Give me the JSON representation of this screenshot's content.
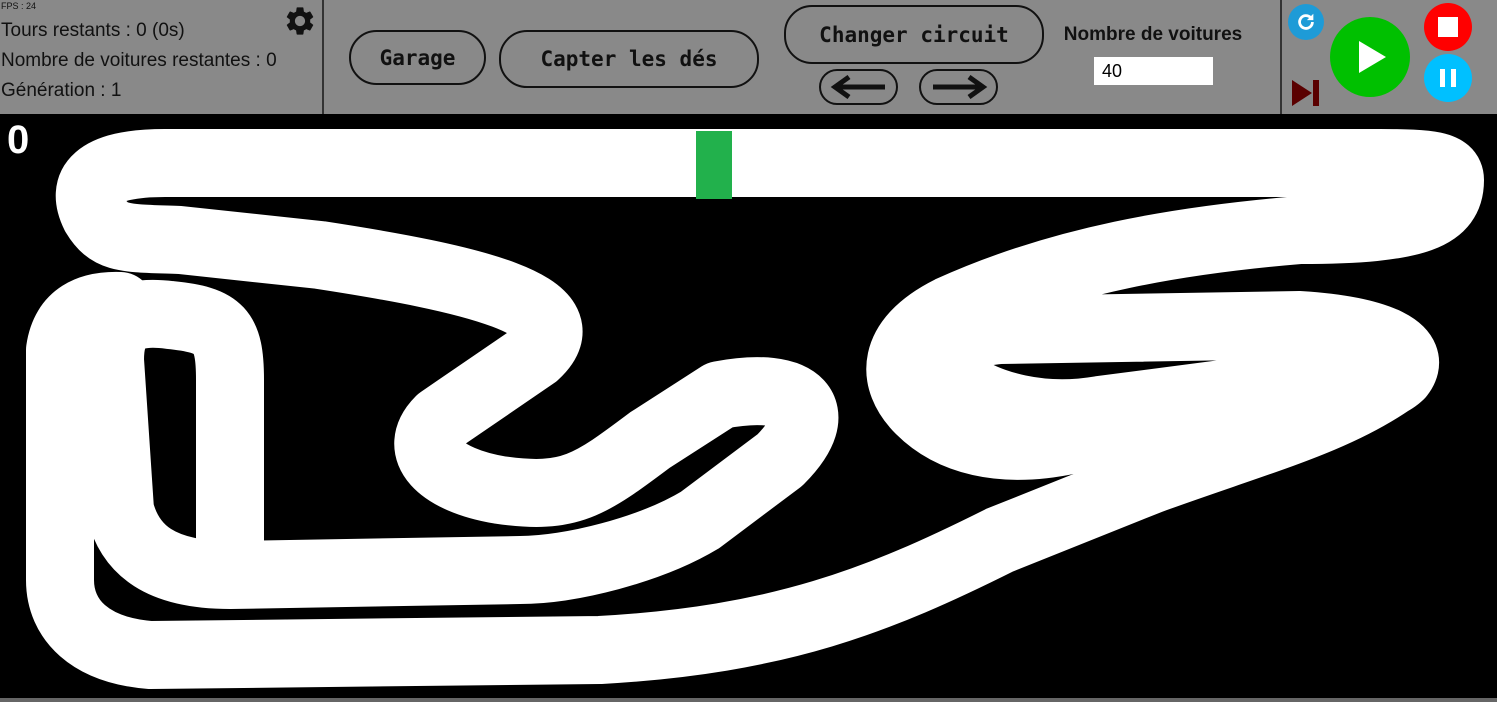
{
  "info": {
    "fps": "FPS : 24",
    "laps_remaining": "Tours restants : 0 (0s)",
    "cars_remaining": "Nombre de voitures restantes : 0",
    "generation": "Génération : 1"
  },
  "icons": {
    "settings": "gear-icon",
    "previous": "arrow-left-icon",
    "next": "arrow-right-icon",
    "reset": "refresh-icon",
    "play": "play-icon",
    "stop": "stop-icon",
    "pause": "pause-icon",
    "skip": "skip-forward-icon"
  },
  "toolbar": {
    "garage_label": "Garage",
    "capture_label": "Capter les dés",
    "change_circuit_label": "Changer circuit"
  },
  "cars": {
    "label": "Nombre de voitures",
    "value": "40"
  },
  "canvas": {
    "counter": "0"
  },
  "colors": {
    "toolbar_bg": "#898989",
    "track": "#ffffff",
    "background": "#000000",
    "finish_line": "#22b14c",
    "play": "#00c000",
    "stop": "#ff0000",
    "pause": "#00c0ff",
    "reset": "#1e9bd7",
    "skip": "#5a0000"
  }
}
